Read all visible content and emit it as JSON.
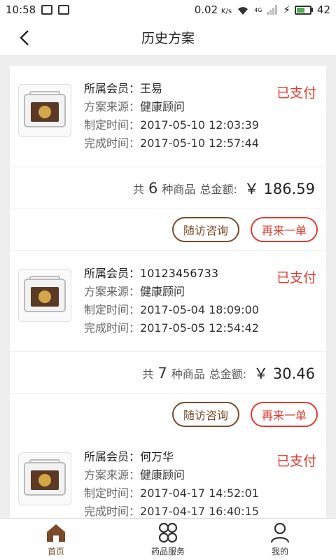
{
  "statusbar": {
    "time": "10:58",
    "speed": "0.02",
    "speed_unit": "K/s",
    "signal": "4G",
    "battery": "42"
  },
  "header": {
    "title": "历史方案"
  },
  "orders": [
    {
      "member_label": "所属会员：",
      "member": "王易",
      "source_label": "方案来源：",
      "source": "健康顾问",
      "created_label": "制定时间：",
      "created": "2017-05-10 12:03:39",
      "finished_label": "完成时间：",
      "finished": "2017-05-10 12:57:44",
      "status": "已支付",
      "count_prefix": "共",
      "count": "6",
      "count_suffix": "种商品",
      "total_label": "总金额:",
      "amount": "￥ 186.59",
      "visit_label": "随访咨询",
      "reorder_label": "再来一单"
    },
    {
      "member_label": "所属会员：",
      "member": "10123456733",
      "source_label": "方案来源：",
      "source": "健康顾问",
      "created_label": "制定时间：",
      "created": "2017-05-04 18:09:00",
      "finished_label": "完成时间：",
      "finished": "2017-05-05 12:54:42",
      "status": "已支付",
      "count_prefix": "共",
      "count": "7",
      "count_suffix": "种商品",
      "total_label": "总金额:",
      "amount": "￥ 30.46",
      "visit_label": "随访咨询",
      "reorder_label": "再来一单"
    },
    {
      "member_label": "所属会员：",
      "member": "何万华",
      "source_label": "方案来源：",
      "source": "健康顾问",
      "created_label": "制定时间：",
      "created": "2017-04-17 14:52:01",
      "finished_label": "完成时间：",
      "finished": "2017-04-17 16:40:15",
      "status": "已支付"
    }
  ],
  "tabbar": {
    "items": [
      {
        "label": "首页",
        "icon": "home-icon"
      },
      {
        "label": "药品服务",
        "icon": "grid-icon"
      },
      {
        "label": "我的",
        "icon": "user-icon"
      }
    ]
  },
  "colors": {
    "accent": "#7a4a2a",
    "status_paid": "#e03a2f",
    "background": "#eeeeee"
  }
}
